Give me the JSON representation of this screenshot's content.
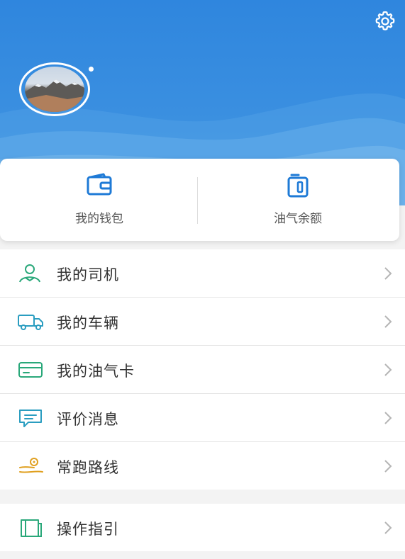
{
  "header": {
    "settings_icon": "gear-icon",
    "avatar_alt": "avatar"
  },
  "quick": [
    {
      "label": "我的钱包",
      "icon": "wallet-icon"
    },
    {
      "label": "油气余额",
      "icon": "balance-card-icon"
    }
  ],
  "menu": [
    {
      "label": "我的司机",
      "icon": "driver-icon",
      "color": "#2aa87a"
    },
    {
      "label": "我的车辆",
      "icon": "truck-icon",
      "color": "#2a9dc0"
    },
    {
      "label": "我的油气卡",
      "icon": "card-icon",
      "color": "#2aa87a"
    },
    {
      "label": "评价消息",
      "icon": "message-icon",
      "color": "#2a9dc0"
    },
    {
      "label": "常跑路线",
      "icon": "route-icon",
      "color": "#e0a020"
    }
  ],
  "menu2": [
    {
      "label": "操作指引",
      "icon": "guide-book-icon",
      "color": "#2aa87a"
    }
  ],
  "colors": {
    "header_blue": "#2f86de",
    "accent_blue": "#1e7ad6",
    "chevron": "#b5b5b5"
  }
}
